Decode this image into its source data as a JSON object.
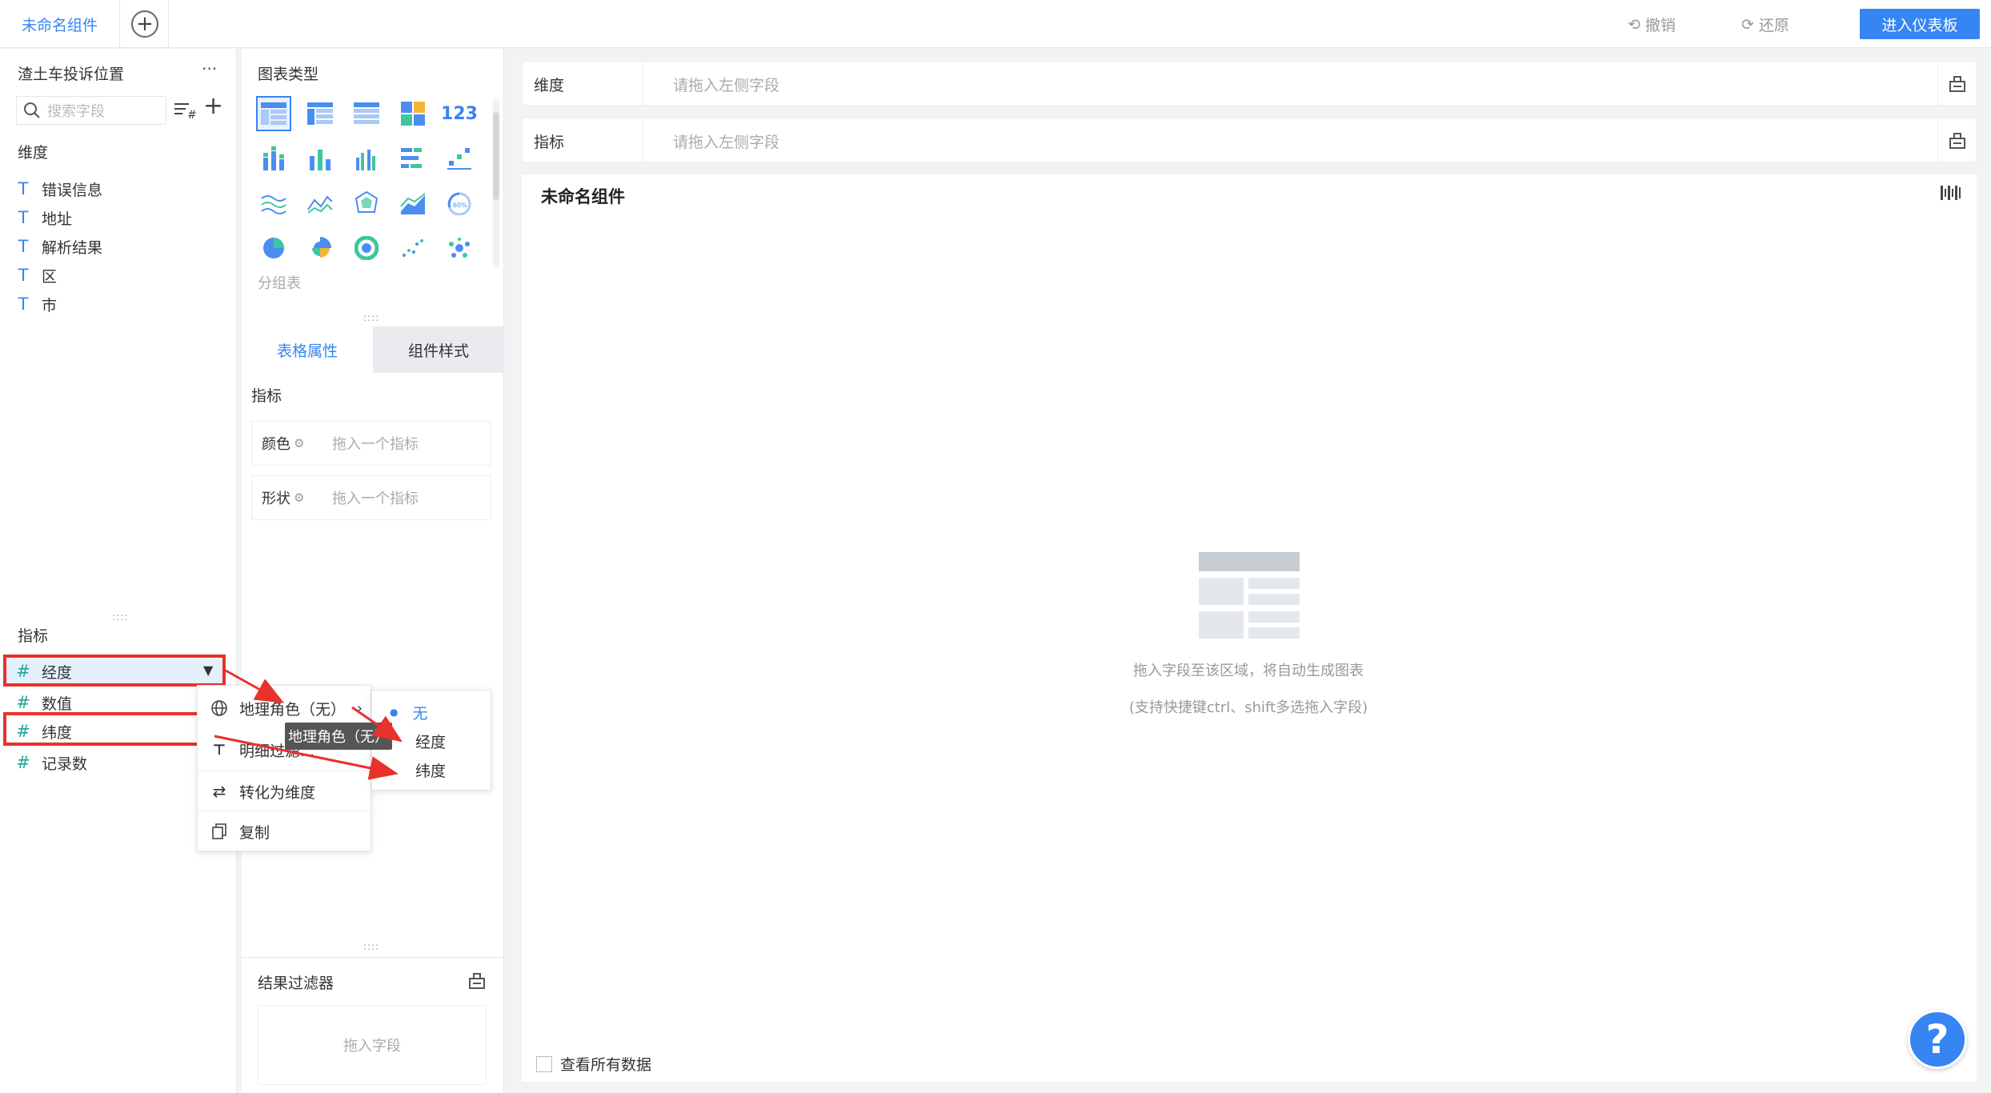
{
  "topbar": {
    "tab_title": "未命名组件",
    "undo_label": "撤销",
    "redo_label": "还原",
    "enter_label": "进入仪表板"
  },
  "left": {
    "dataset_name": "渣土车投诉位置",
    "more": "···",
    "search_placeholder": "搜索字段",
    "dim_title": "维度",
    "dimensions": [
      "错误信息",
      "地址",
      "解析结果",
      "区",
      "市"
    ],
    "measure_title": "指标",
    "measures": [
      "经度",
      "数值",
      "纬度",
      "记录数"
    ]
  },
  "mid": {
    "chart_type_title": "图表类型",
    "chart_type_hint": "分组表",
    "tabs": [
      "表格属性",
      "组件样式"
    ],
    "measure_title": "指标",
    "color_label": "颜色",
    "shape_label": "形状",
    "drop_placeholder": "拖入一个指标",
    "filter_title": "结果过滤器",
    "filter_placeholder": "拖入字段"
  },
  "menu": {
    "geo_role": "地理角色（无）",
    "detail_filter": "明细过滤...",
    "to_dimension": "转化为维度",
    "copy": "复制",
    "tooltip": "地理角色（无）",
    "sub_items": [
      "无",
      "经度",
      "纬度"
    ]
  },
  "right": {
    "dim_label": "维度",
    "measure_label": "指标",
    "placeholder": "请拖入左侧字段",
    "component_title": "未命名组件",
    "empty_line1": "拖入字段至该区域，将自动生成图表",
    "empty_line2": "(支持快捷键ctrl、shift多选拖入字段)",
    "view_all": "查看所有数据"
  },
  "help": "?",
  "colors": {
    "primary": "#3685f2",
    "highlight": "#e8322b",
    "measure_icon": "#22a69a"
  }
}
